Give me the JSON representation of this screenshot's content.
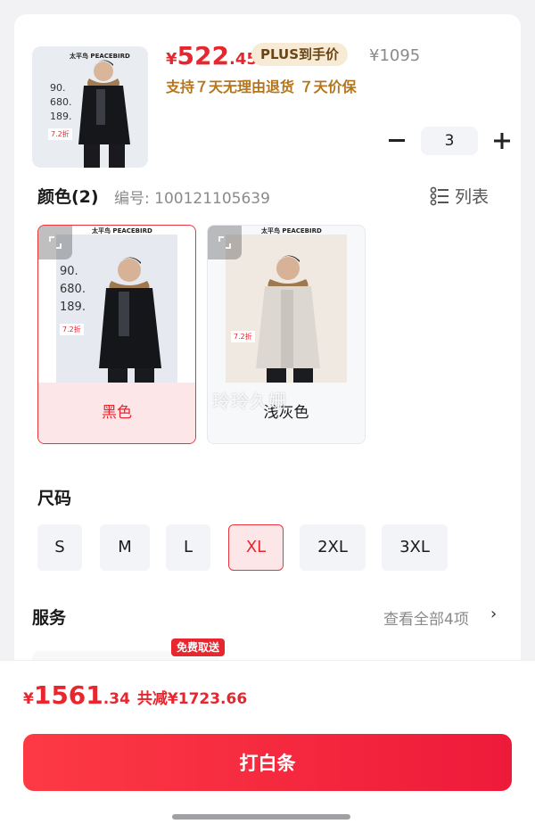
{
  "product": {
    "thumb_brand": "太平鸟 PEACEBIRD",
    "thumb_numbers": [
      "90.",
      "680.",
      "189."
    ],
    "thumb_tag": "7.2折",
    "price_currency": "¥",
    "price_int": "522",
    "price_dec": ".45",
    "plus_tag": "PLUS到手价",
    "original_price": "¥1095",
    "guarantee": "支持７天无理由退货 ７天价保",
    "quantity": "3",
    "minus": "−",
    "plus": "+"
  },
  "color_section": {
    "title": "颜色(2)",
    "code": "编号: 100121105639",
    "list_toggle": "列表",
    "options": [
      {
        "label": "黑色",
        "brand": "太平鸟 PEACEBIRD",
        "numbers": [
          "90.",
          "680.",
          "189."
        ],
        "tag": "7.2折",
        "selected": true
      },
      {
        "label": "浅灰色",
        "brand": "太平鸟 PEACEBIRD",
        "numbers": [],
        "tag": "7.2折",
        "selected": false
      }
    ],
    "watermark": "玲玲久姗"
  },
  "size_section": {
    "title": "尺码",
    "options": [
      "S",
      "M",
      "L",
      "XL",
      "2XL",
      "3XL"
    ],
    "selected": "XL"
  },
  "service_section": {
    "title": "服务",
    "see_all": "查看全部4项",
    "chevron": "›",
    "free_tag": "免费取送"
  },
  "footer": {
    "total_currency": "¥",
    "total_int": "1561",
    "total_dec": ".34",
    "discount": "共减¥1723.66",
    "cta": "打白条"
  },
  "colors": {
    "accent": "#e8262e",
    "gold": "#b4751c",
    "plus_bg": "#f7ebd6",
    "selected_bg": "#fde6e8"
  }
}
